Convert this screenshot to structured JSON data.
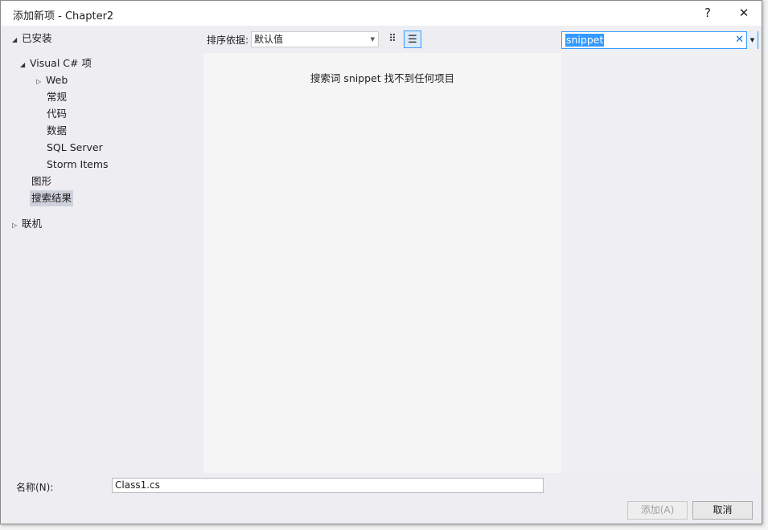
{
  "window": {
    "title": "添加新项 - Chapter2",
    "help": "?",
    "close": "✕"
  },
  "tree": {
    "installed": "已安装",
    "visual_cs": "Visual C# 项",
    "web": "Web",
    "general": "常规",
    "code": "代码",
    "data": "数据",
    "sql": "SQL Server",
    "storm": "Storm Items",
    "graphics": "图形",
    "search_results": "搜索结果",
    "online": "联机"
  },
  "toolbar": {
    "sort_label": "排序依据:",
    "sort_value": "默认值"
  },
  "search": {
    "value": "snippet"
  },
  "main": {
    "message": "搜索词 snippet 找不到任何项目"
  },
  "footer": {
    "name_label": "名称(N):",
    "name_value": "Class1.cs",
    "add": "添加(A)",
    "cancel": "取消"
  }
}
